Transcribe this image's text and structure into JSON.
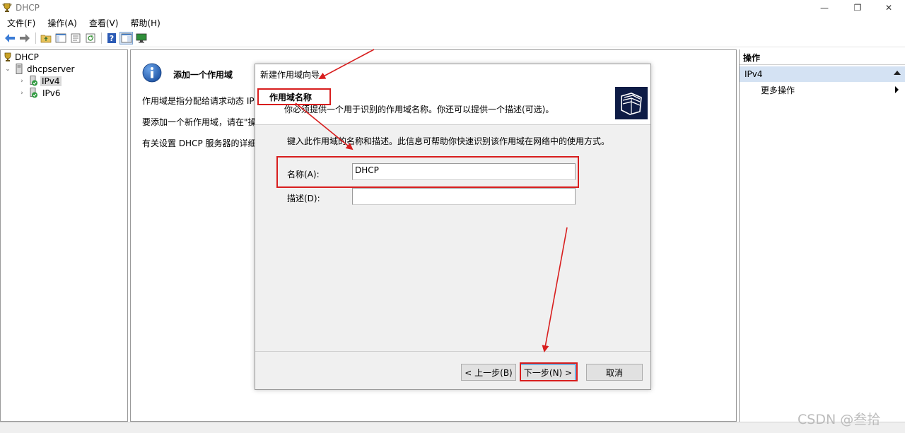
{
  "window": {
    "title": "DHCP",
    "minimize_glyph": "—",
    "restore_glyph": "❐",
    "close_glyph": "✕"
  },
  "menu": [
    "文件(F)",
    "操作(A)",
    "查看(V)",
    "帮助(H)"
  ],
  "toolbar": {
    "icons": [
      "back-arrow-icon",
      "forward-arrow-icon",
      "folder-up-icon",
      "console-tree-icon",
      "properties-icon",
      "refresh-icon",
      "help-icon",
      "show-hide-pane-icon",
      "monitor-icon"
    ]
  },
  "tree": {
    "root": "DHCP",
    "server": "dhcpserver",
    "children": [
      "IPv4",
      "IPv6"
    ],
    "selected": "IPv4"
  },
  "center": {
    "title": "添加一个作用域",
    "paragraphs": [
      "作用域是指分配给请求动态 IP 地",
      "要添加一个新作用域，请在\"操作",
      "有关设置 DHCP 服务器的详细情"
    ]
  },
  "actions": {
    "header": "操作",
    "section": "IPv4",
    "items": [
      "更多操作"
    ]
  },
  "wizard": {
    "title": "新建作用域向导",
    "step_title": "作用域名称",
    "step_desc": "你必须提供一个用于识别的作用域名称。你还可以提供一个描述(可选)。",
    "hint": "键入此作用域的名称和描述。此信息可帮助你快速识别该作用域在网络中的使用方式。",
    "name_label": "名称(A):",
    "name_value": "DHCP",
    "desc_label": "描述(D):",
    "desc_value": "",
    "back_label": "< 上一步(B)",
    "next_label": "下一步(N) >",
    "cancel_label": "取消"
  },
  "annotation_color": "#d81e1e",
  "watermark": "CSDN @叁拾"
}
